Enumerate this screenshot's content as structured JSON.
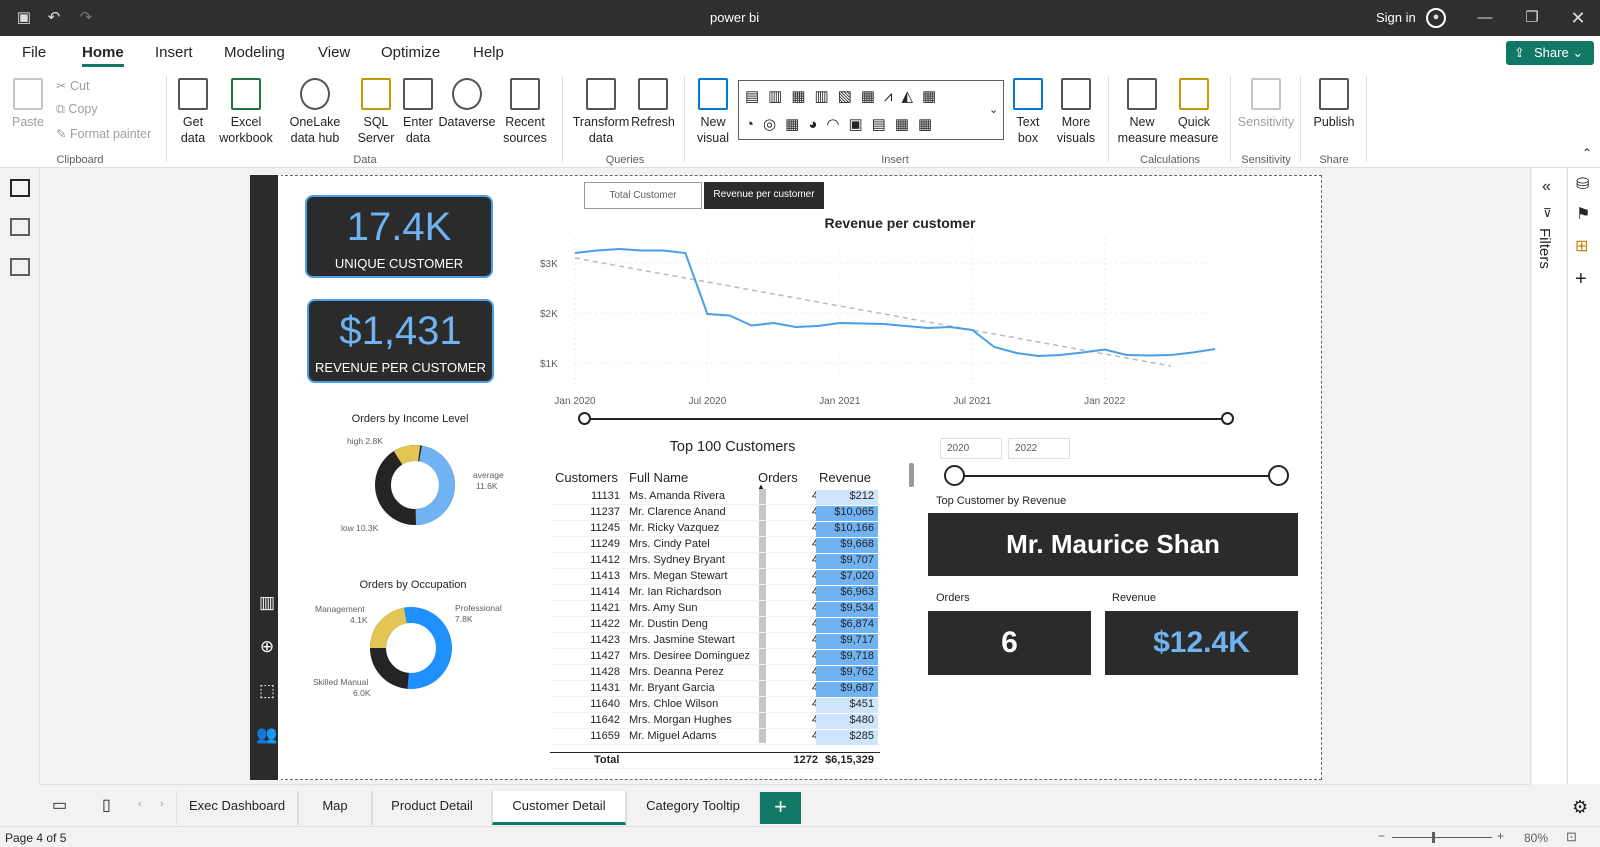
{
  "app": {
    "title": "power bi",
    "sign_in": "Sign in"
  },
  "menu": {
    "items": [
      "File",
      "Home",
      "Insert",
      "Modeling",
      "View",
      "Optimize",
      "Help"
    ],
    "share": "Share"
  },
  "ribbon": {
    "clipboard": {
      "paste": "Paste",
      "cut": "Cut",
      "copy": "Copy",
      "format_painter": "Format painter",
      "group": "Clipboard"
    },
    "data": {
      "get_data": "Get data",
      "excel": "Excel workbook",
      "onelake": "OneLake data hub",
      "sql": "SQL Server",
      "enter": "Enter data",
      "dataverse": "Dataverse",
      "recent": "Recent sources",
      "group": "Data"
    },
    "queries": {
      "transform": "Transform data",
      "refresh": "Refresh",
      "group": "Queries"
    },
    "insert": {
      "new_visual": "New visual",
      "text_box": "Text box",
      "more_visuals": "More visuals",
      "group": "Insert"
    },
    "calculations": {
      "new_measure": "New measure",
      "quick_measure": "Quick measure",
      "group": "Calculations"
    },
    "sensitivity": {
      "label": "Sensitivity",
      "group": "Sensitivity"
    },
    "share": {
      "publish": "Publish",
      "group": "Share"
    }
  },
  "report": {
    "kpi1": {
      "value": "17.4K",
      "label": "UNIQUE CUSTOMER"
    },
    "kpi2": {
      "value": "$1,431",
      "label": "REVENUE PER CUSTOMER"
    },
    "donut1": {
      "title": "Orders by Income Level",
      "labels": [
        {
          "name": "high",
          "value": "2.8K"
        },
        {
          "name": "average",
          "value": "11.6K"
        },
        {
          "name": "low",
          "value": "10.3K"
        }
      ],
      "label_high": "high 2.8K",
      "label_avg": "average",
      "label_avg_v": "11.6K",
      "label_low": "low 10.3K"
    },
    "donut2": {
      "title": "Orders by Occupation",
      "label_mgmt": "Management",
      "label_mgmt_v": "4.1K",
      "label_prof": "Professional",
      "label_prof_v": "7.8K",
      "label_skill": "Skilled Manual",
      "label_skill_v": "6.0K"
    },
    "buttons": {
      "total": "Total Customer",
      "revenue": "Revenue per customer"
    },
    "table": {
      "title": "Top 100 Customers",
      "headers": [
        "Customers",
        "Full Name",
        "Orders",
        "Revenue"
      ],
      "rows": [
        [
          "11131",
          "Ms. Amanda Rivera",
          "4",
          "$212"
        ],
        [
          "11237",
          "Mr. Clarence Anand",
          "4",
          "$10,065"
        ],
        [
          "11245",
          "Mr. Ricky Vazquez",
          "4",
          "$10,166"
        ],
        [
          "11249",
          "Mrs. Cindy Patel",
          "4",
          "$9,668"
        ],
        [
          "11412",
          "Mrs. Sydney Bryant",
          "4",
          "$9,707"
        ],
        [
          "11413",
          "Mrs. Megan Stewart",
          "4",
          "$7,020"
        ],
        [
          "11414",
          "Mr. Ian Richardson",
          "4",
          "$6,963"
        ],
        [
          "11421",
          "Mrs. Amy Sun",
          "4",
          "$9,534"
        ],
        [
          "11422",
          "Mr. Dustin Deng",
          "4",
          "$6,874"
        ],
        [
          "11423",
          "Mrs. Jasmine Stewart",
          "4",
          "$9,717"
        ],
        [
          "11427",
          "Mrs. Desiree Dominguez",
          "4",
          "$9,718"
        ],
        [
          "11428",
          "Mrs. Deanna Perez",
          "4",
          "$9,762"
        ],
        [
          "11431",
          "Mr. Bryant Garcia",
          "4",
          "$9,687"
        ],
        [
          "11640",
          "Mrs. Chloe Wilson",
          "4",
          "$451"
        ],
        [
          "11642",
          "Mrs. Morgan Hughes",
          "4",
          "$480"
        ],
        [
          "11659",
          "Mr. Miguel Adams",
          "4",
          "$285"
        ]
      ],
      "total_label": "Total",
      "total_orders": "1272",
      "total_revenue": "$6,15,329"
    },
    "year_from": "2020",
    "year_to": "2022",
    "top_customer": {
      "caption": "Top Customer by Revenue",
      "name": "Mr. Maurice Shan"
    },
    "orders": {
      "caption": "Orders",
      "value": "6"
    },
    "revenue": {
      "caption": "Revenue",
      "value": "$12.4K"
    }
  },
  "chart_data": {
    "type": "line",
    "title": "Revenue per customer",
    "x": [
      "2020-01",
      "2020-02",
      "2020-03",
      "2020-04",
      "2020-05",
      "2020-06",
      "2020-07",
      "2020-08",
      "2020-09",
      "2020-10",
      "2020-11",
      "2020-12",
      "2021-01",
      "2021-02",
      "2021-03",
      "2021-04",
      "2021-05",
      "2021-06",
      "2021-07",
      "2021-08",
      "2021-09",
      "2021-10",
      "2021-11",
      "2021-12",
      "2022-01",
      "2022-02",
      "2022-03",
      "2022-04",
      "2022-05",
      "2022-06"
    ],
    "xticks": [
      "Jan 2020",
      "Jul 2020",
      "Jan 2021",
      "Jul 2021",
      "Jan 2022"
    ],
    "yticks": [
      "$3K",
      "$2K",
      "$1K"
    ],
    "ylim": [
      500,
      3500
    ],
    "series": [
      {
        "values": [
          3200,
          3250,
          3280,
          3250,
          3250,
          3200,
          1980,
          1950,
          1750,
          1800,
          1720,
          1740,
          1800,
          1790,
          1780,
          1740,
          1700,
          1720,
          1660,
          1320,
          1200,
          1140,
          1160,
          1210,
          1270,
          1160,
          1150,
          1160,
          1210,
          1280
        ]
      },
      {
        "values": [
          3100,
          3020,
          2940,
          2860,
          2780,
          2700,
          2620,
          2540,
          2460,
          2380,
          2300,
          2220,
          2140,
          2060,
          1980,
          1900,
          1820,
          1740,
          1660,
          1580,
          1500,
          1420,
          1340,
          1260,
          1180,
          1100,
          1020,
          940
        ]
      }
    ],
    "grid": true
  },
  "pages": {
    "tabs": [
      "Exec Dashboard",
      "Map",
      "Product Detail",
      "Customer Detail",
      "Category Tooltip"
    ],
    "add": "+"
  },
  "status": {
    "page": "Page 4 of 5",
    "zoom": "80%"
  },
  "filters": {
    "label": "Filters"
  }
}
